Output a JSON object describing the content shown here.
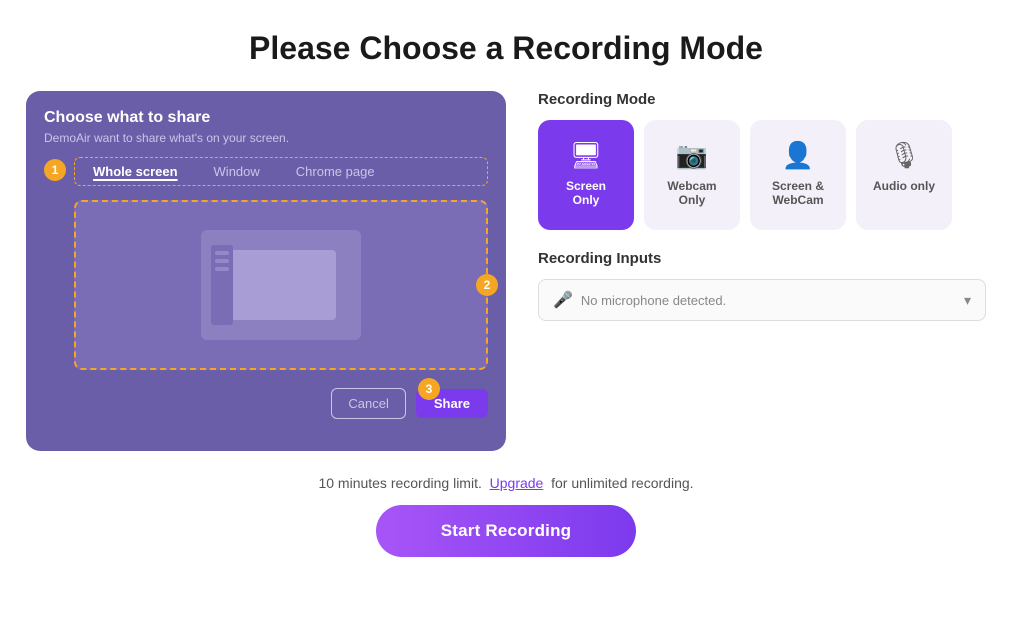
{
  "page": {
    "title": "Please Choose a Recording Mode"
  },
  "share_panel": {
    "title": "Choose what to share",
    "subtitle": "DemoAir want to share what's on your screen.",
    "tabs": [
      {
        "label": "Whole screen",
        "active": true
      },
      {
        "label": "Window",
        "active": false
      },
      {
        "label": "Chrome page",
        "active": false
      }
    ],
    "step1": "1",
    "step2": "2",
    "step3": "3",
    "cancel_label": "Cancel",
    "share_label": "Share"
  },
  "recording_mode": {
    "section_label": "Recording Mode",
    "modes": [
      {
        "id": "screen-only",
        "label": "Screen Only",
        "icon": "🖥",
        "active": true
      },
      {
        "id": "webcam-only",
        "label": "Webcam Only",
        "icon": "📷",
        "active": false
      },
      {
        "id": "screen-webcam",
        "label": "Screen & WebCam",
        "icon": "👤",
        "active": false
      },
      {
        "id": "audio-only",
        "label": "Audio only",
        "icon": "🎙",
        "active": false
      }
    ]
  },
  "recording_inputs": {
    "section_label": "Recording Inputs",
    "microphone_placeholder": "No microphone detected."
  },
  "bottom": {
    "upgrade_text_prefix": "10 minutes recording limit.",
    "upgrade_link_text": "Upgrade",
    "upgrade_text_suffix": "for unlimited recording.",
    "start_recording_label": "Start Recording"
  }
}
